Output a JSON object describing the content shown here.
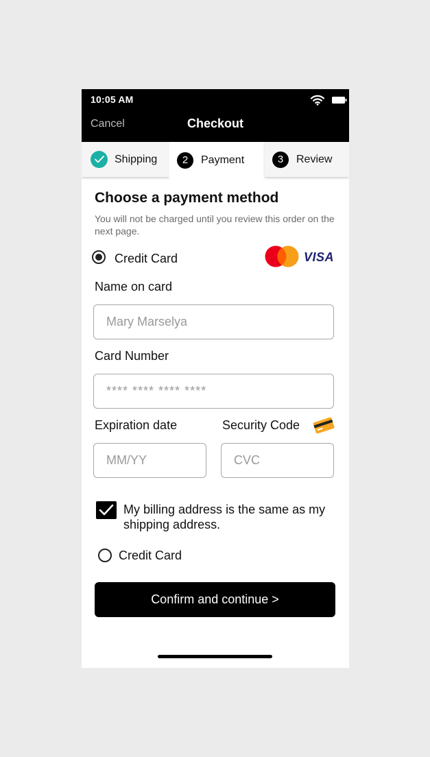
{
  "status_bar": {
    "time": "10:05 AM"
  },
  "header": {
    "cancel_label": "Cancel",
    "title": "Checkout"
  },
  "steps": [
    {
      "label": "Shipping",
      "state": "completed",
      "icon": "check-icon"
    },
    {
      "number": "2",
      "label": "Payment",
      "state": "active"
    },
    {
      "number": "3",
      "label": "Review",
      "state": "upcoming"
    }
  ],
  "content": {
    "heading": "Choose a payment method",
    "subtext": "You will not be charged until you review this order on the next page."
  },
  "payment_method": {
    "label": "Credit Card",
    "selected": true,
    "brands": [
      "mastercard-logo",
      "VISA"
    ]
  },
  "form": {
    "name_label": "Name on card",
    "name_placeholder": "Mary Marselya",
    "card_label": "Card Number",
    "card_placeholder": "**** **** **** ****",
    "exp_label": "Expiration date",
    "exp_placeholder": "MM/YY",
    "sec_label": "Security Code",
    "sec_placeholder": "CVC"
  },
  "billing": {
    "checked": true,
    "label": "My billing address is the same as my shipping address."
  },
  "alt_method": {
    "label": "Credit Card",
    "selected": false
  },
  "confirm_button": {
    "label": "Confirm and continue >"
  },
  "colors": {
    "accent_teal": "#1bb0a5",
    "primary": "#000000",
    "visa_blue": "#1a1f71",
    "mastercard_red": "#eb001b",
    "mastercard_orange": "#f79e1b"
  }
}
